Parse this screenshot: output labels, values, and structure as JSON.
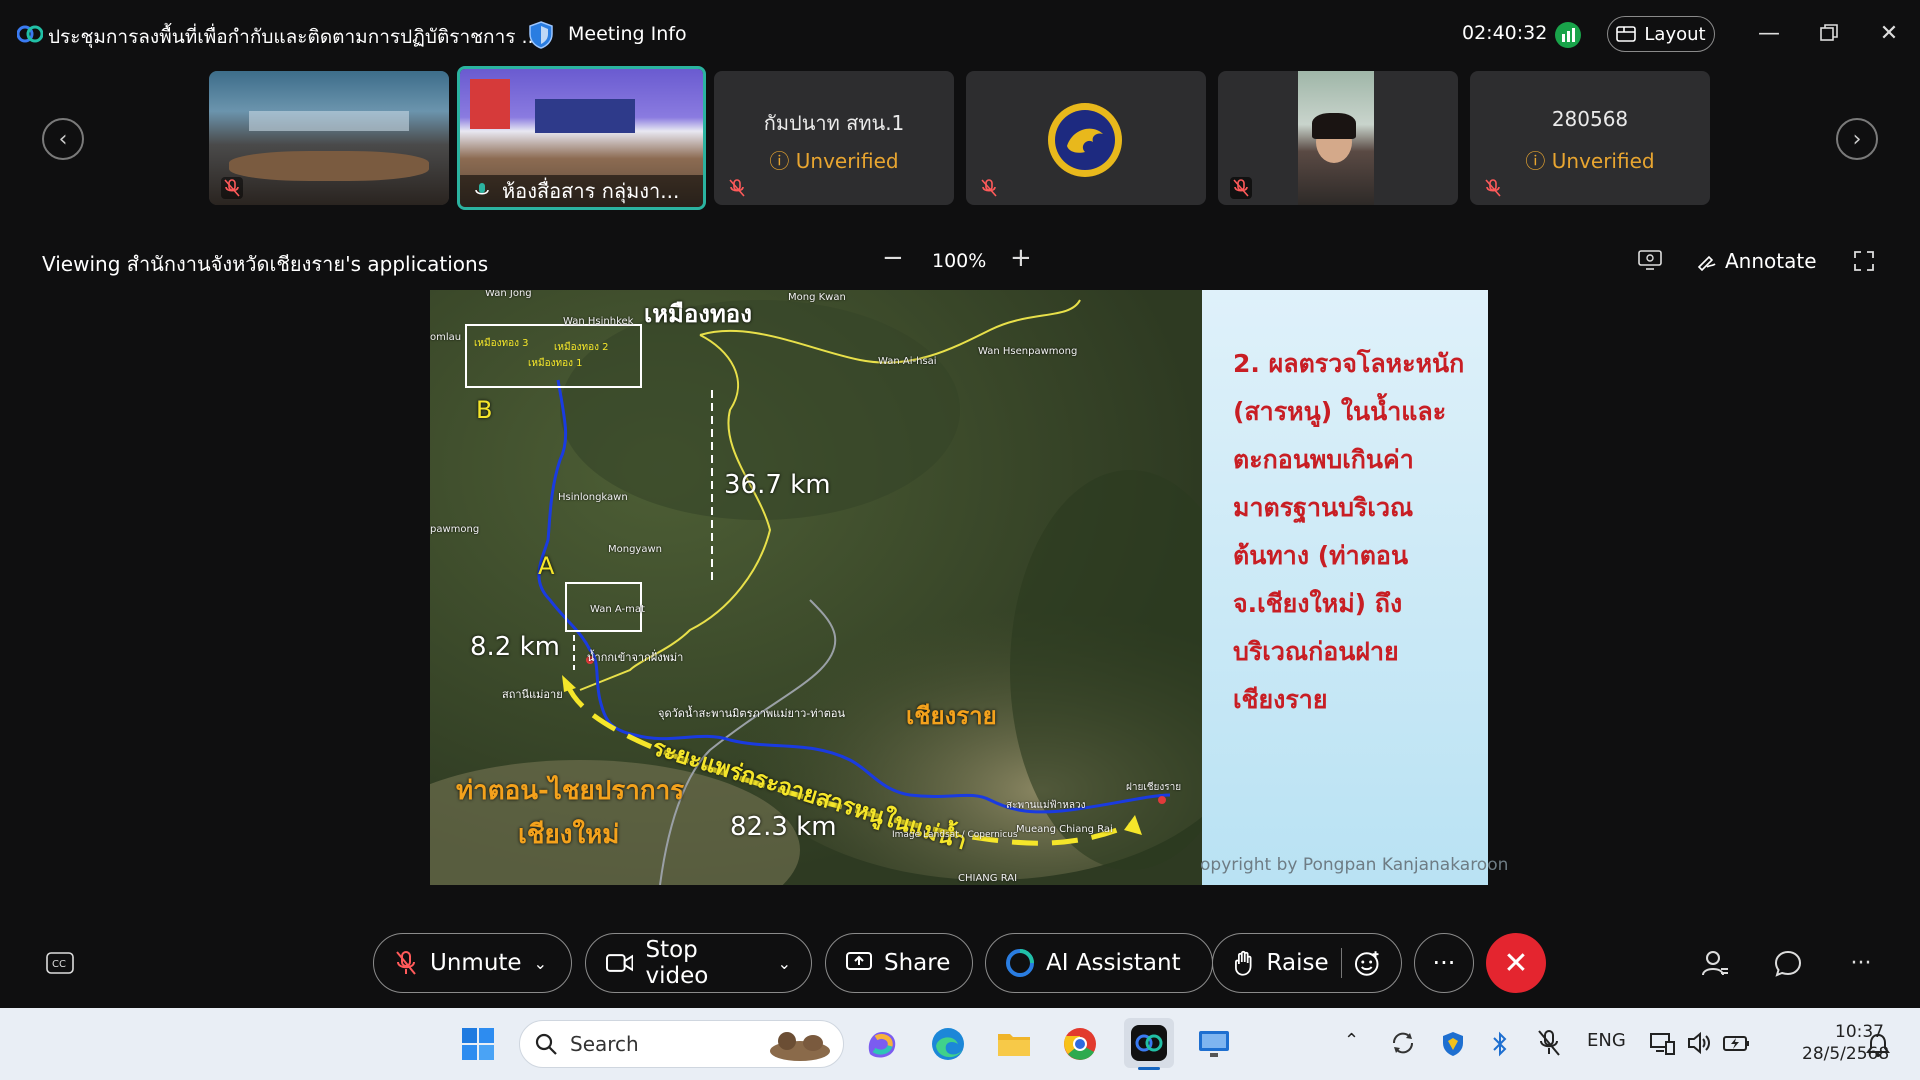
{
  "titlebar": {
    "meeting_title": "ประชุมการลงพื้นที่เพื่อกำกับและติดตามการปฏิบัติราชการ ...",
    "meeting_info": "Meeting Info",
    "clock": "02:40:32",
    "layout_label": "Layout"
  },
  "participants": [
    {
      "name": "",
      "status": "",
      "type": "video"
    },
    {
      "name": "ห้องสื่อสาร กลุ่มงา...",
      "status": "",
      "type": "video",
      "active": true
    },
    {
      "name": "กัมปนาท สทน.1",
      "status": "Unverified",
      "type": "name"
    },
    {
      "name": "",
      "status": "",
      "type": "logo"
    },
    {
      "name": "",
      "status": "",
      "type": "video"
    },
    {
      "name": "280568",
      "status": "Unverified",
      "type": "name"
    }
  ],
  "share_bar": {
    "viewing": "Viewing สำนักงานจังหวัดเชียงราย's applications",
    "zoom_minus": "−",
    "zoom_level": "100%",
    "zoom_plus": "+",
    "annotate": "Annotate"
  },
  "slide": {
    "panel_text": "2. ผลตรวจโลหะหนัก (สารหนู) ในน้ำและตะกอนพบเกินค่ามาตรฐานบริเวณต้นทาง (ท่าตอน จ.เชียงใหม่) ถึงบริเวณก่อนฝายเชียงราย",
    "copyright": "opyright by Pongpan Kanjanakaroon",
    "map_labels": {
      "mueang_thong": "เหมืองทอง",
      "box_b_text1": "เหมืองทอง 3",
      "box_b_text2": "เหมืองทอง 2",
      "box_b_text3": "เหมืองทอง 1",
      "wan_jong": "Wan Jong",
      "mong_kwan": "Mong Kwan",
      "wan_hsinhkek": "Wan Hsinhkek",
      "omlau": "omlau",
      "wan_ai_hsai": "Wan Ai-hsai",
      "wan_hsenpawmong": "Wan Hsenpawmong",
      "hsinlongkawn": "Hsinlongkawn",
      "pawmong": "pawmong",
      "mongyawn": "Mongyawn",
      "wan_a_mat": "Wan A-mat",
      "label_b": "B",
      "label_a": "A",
      "km_367": "36.7 km",
      "km_82": "8.2 km",
      "km_823": "82.3 km",
      "entry": "น้ำกกเข้าจากฝั่งพม่า",
      "station": "สถานีแม่อาย",
      "station_mid": "จุดวัดน้ำสะพานมิตรภาพแม่ยาว-ท่าตอน",
      "chiang_rai_th": "เชียงราย",
      "spread": "ระยะแพร่กระจายสารหนูในแม่น้ำ",
      "tha_ton": "ท่าตอน-ไชยปราการ",
      "chiang_mai": "เชียงใหม่",
      "weir": "ฝายเชียงราย",
      "bridge": "สะพานแม่ฟ้าหลวง",
      "mueang_cr": "Mueang Chiang Rai",
      "chiang_rai_en": "CHIANG RAI",
      "image_credit": "Image Landsat / Copernicus"
    }
  },
  "controls": {
    "unmute": "Unmute",
    "stop_video": "Stop video",
    "share": "Share",
    "ai_assistant": "AI Assistant",
    "raise": "Raise",
    "more": "···",
    "end": "✕"
  },
  "taskbar": {
    "search": "Search",
    "lang": "ENG",
    "time": "10:37",
    "date": "28/5/2568"
  },
  "colors": {
    "accent_teal": "#2bb3a0",
    "end_red": "#e4252f",
    "unverified": "#e8a530",
    "panel_text": "#c81e24"
  }
}
